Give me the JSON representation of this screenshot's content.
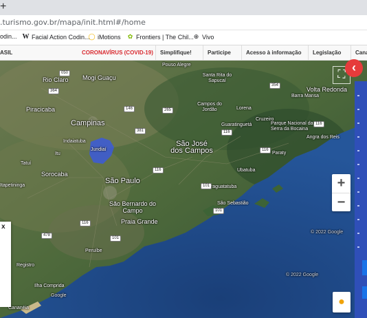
{
  "browser": {
    "newtab_glyph": "+",
    "url": ".turismo.gov.br/mapa/init.html#/home"
  },
  "bookmarks": [
    {
      "label": "odin...",
      "icon": "bookmark-icon"
    },
    {
      "label": "Facial Action Codin...",
      "icon": "wikipedia-icon"
    },
    {
      "label": "iMotions",
      "icon": "imotions-icon"
    },
    {
      "label": "Frontiers | The Chil...",
      "icon": "frontiers-icon"
    },
    {
      "label": "Vivo",
      "icon": "globe-icon"
    }
  ],
  "govbar": {
    "items": [
      "ASIL",
      "CORONAVÍRUS (COVID-19)",
      "Simplifique!",
      "Participe",
      "Acesso à informação",
      "Legislação",
      "Cana"
    ],
    "highlight_color": "#d8282e"
  },
  "map": {
    "cities": [
      {
        "name": "Rio Claro"
      },
      {
        "name": "Mogi Guaçu"
      },
      {
        "name": "Piracicaba"
      },
      {
        "name": "Campinas"
      },
      {
        "name": "Indaiatuba"
      },
      {
        "name": "Jundiaí"
      },
      {
        "name": "Sorocaba"
      },
      {
        "name": "São Paulo"
      },
      {
        "name": "São Bernardo do Campo"
      },
      {
        "name": "Praia Grande"
      },
      {
        "name": "São José dos Campos"
      },
      {
        "name": "Campos do Jordão"
      },
      {
        "name": "Guaratinguetá"
      },
      {
        "name": "Pouso Alegre"
      },
      {
        "name": "Santa Rita do Sapucaí"
      },
      {
        "name": "Volta Redonda"
      },
      {
        "name": "Barra Mansa"
      },
      {
        "name": "Parque Nacional da Serra da Bocaina"
      },
      {
        "name": "Angra dos Reis"
      },
      {
        "name": "Paraty"
      },
      {
        "name": "Ubatuba"
      },
      {
        "name": "Caraguatatuba"
      },
      {
        "name": "São Sebastião"
      },
      {
        "name": "Peruíbe"
      },
      {
        "name": "Registro"
      },
      {
        "name": "Ilha Comprida"
      },
      {
        "name": "Cananéia"
      },
      {
        "name": "Tatuí"
      },
      {
        "name": "Itapetininga"
      },
      {
        "name": "Lorena"
      },
      {
        "name": "Cruzeiro"
      },
      {
        "name": "Itu"
      }
    ],
    "watermark": "Google",
    "copyright": "© 2022 Google",
    "zoom_in": "+",
    "zoom_out": "−",
    "fullscreen_icon": "⛶",
    "back_icon": "‹",
    "close_x": "x",
    "highlight_color": "#3b5bdb"
  }
}
